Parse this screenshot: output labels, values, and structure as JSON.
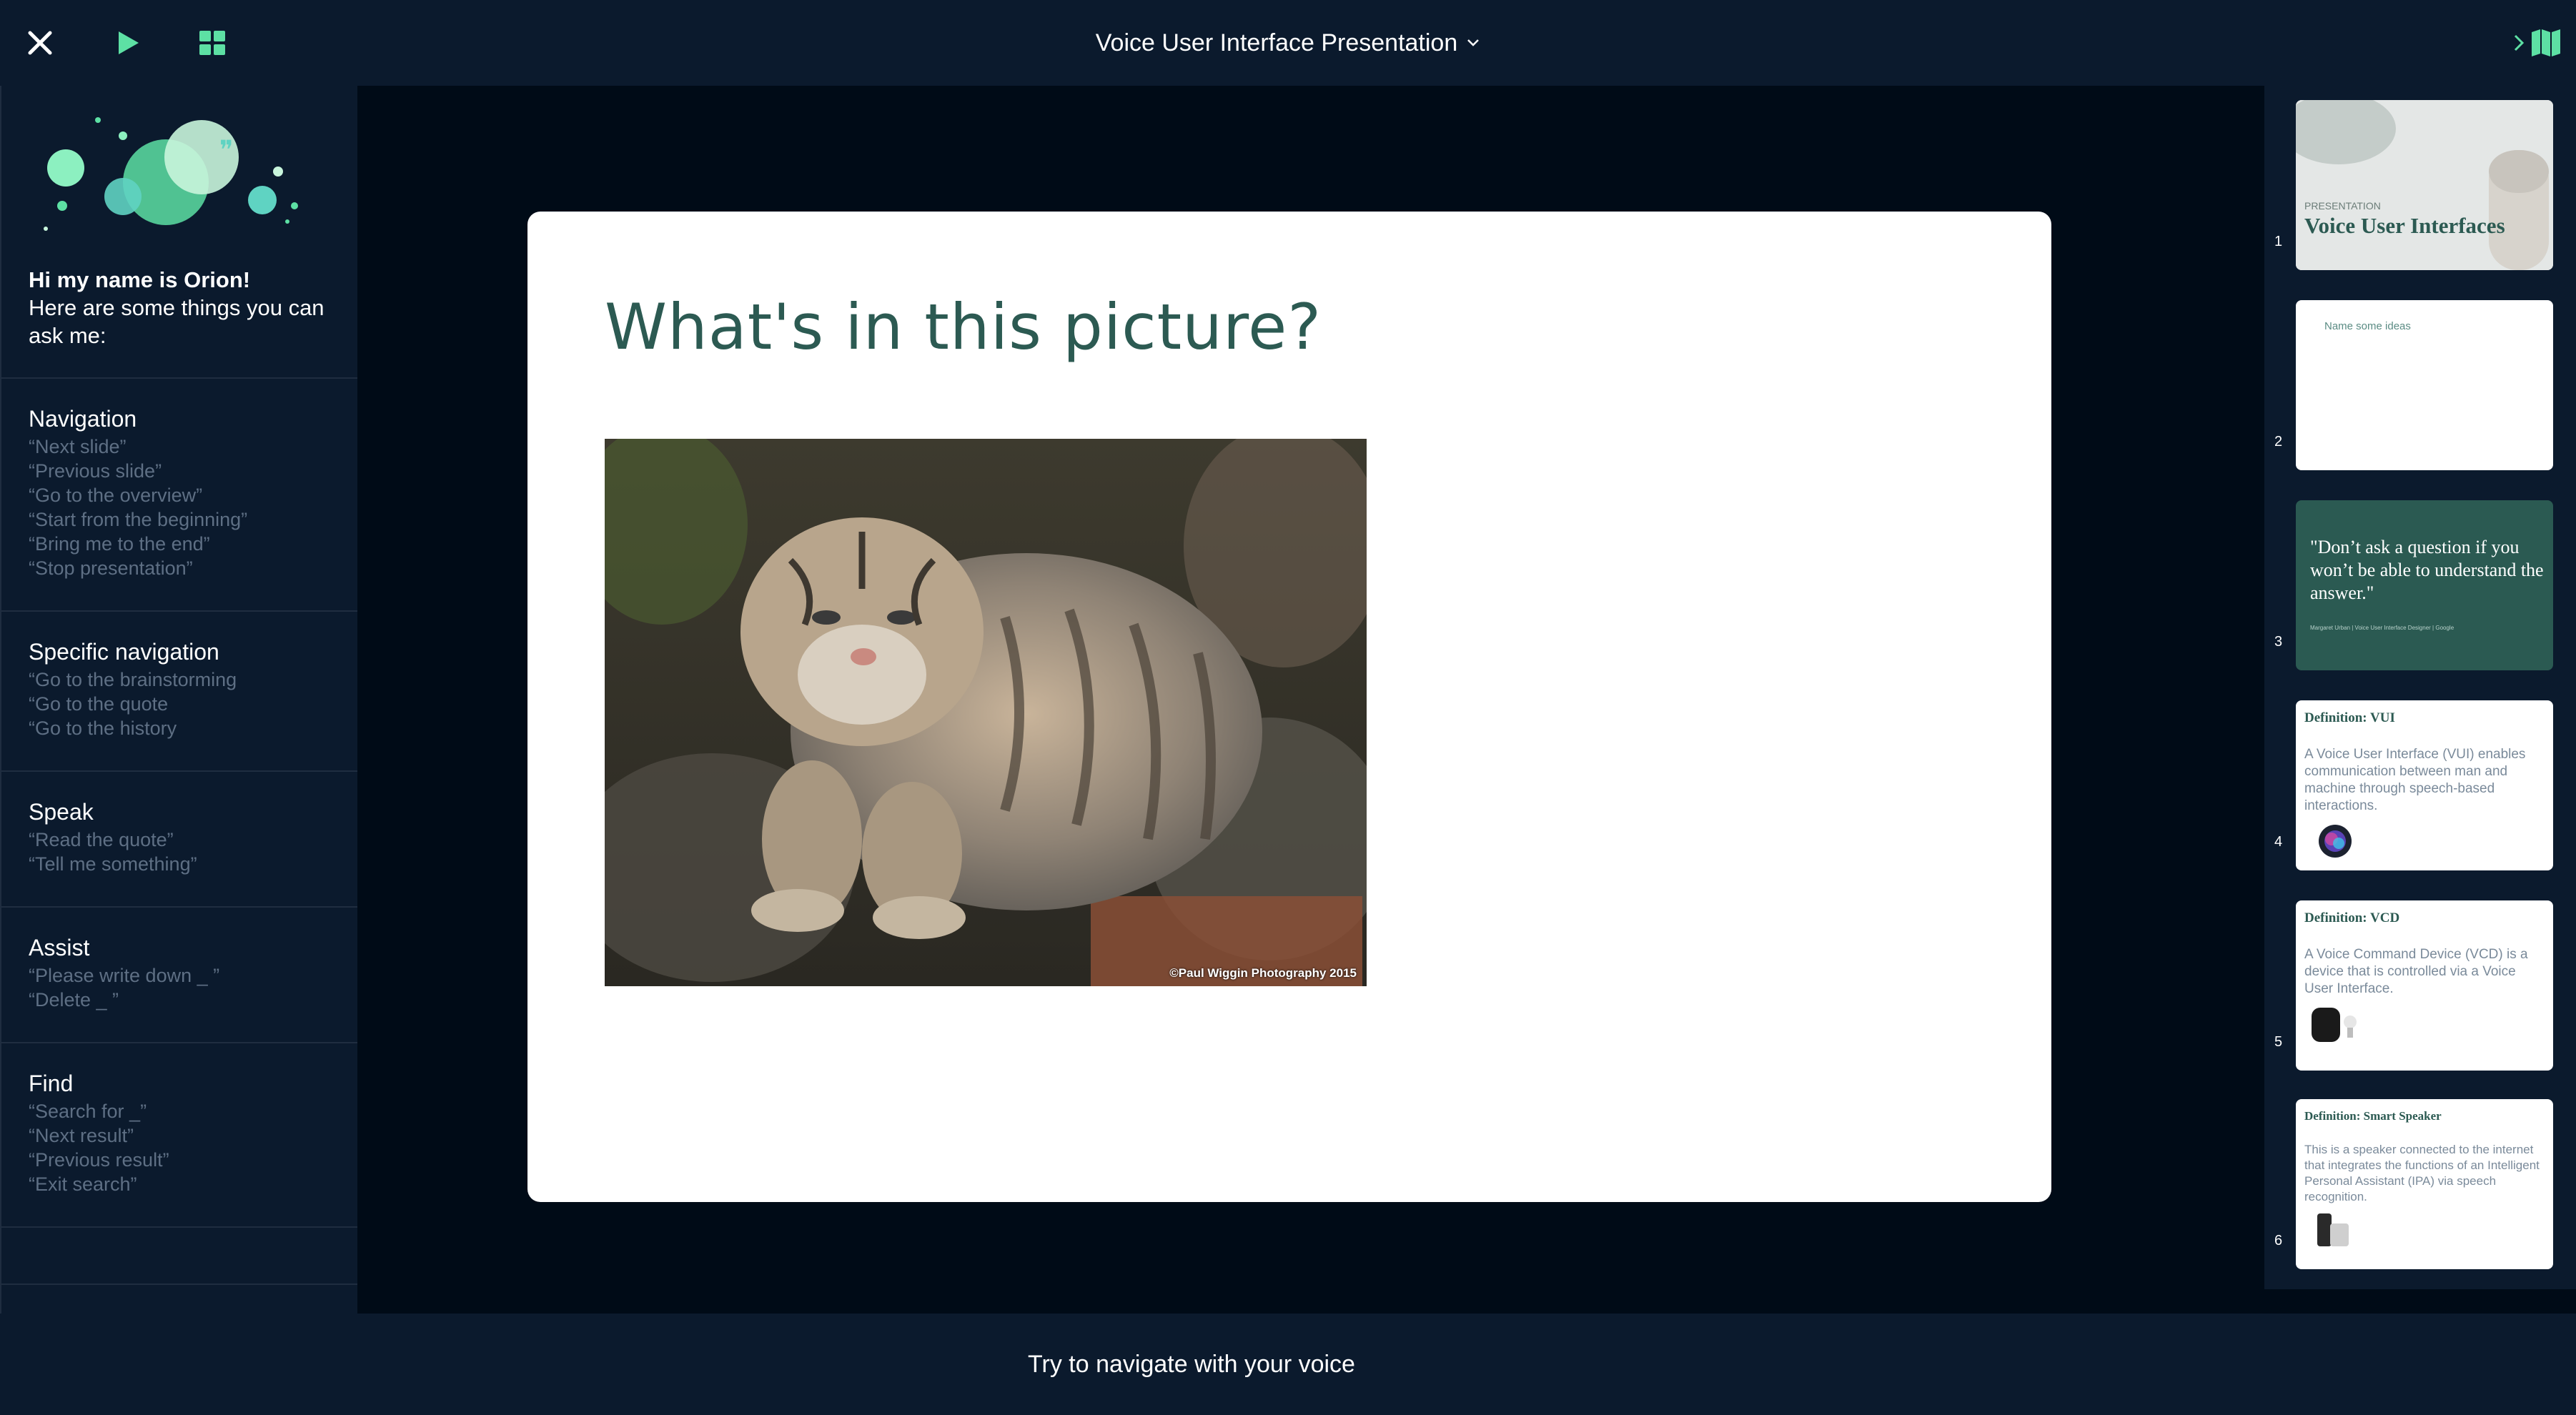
{
  "header": {
    "title": "Voice User Interface Presentation",
    "close_icon": "close-icon",
    "play_icon": "play-icon",
    "grid_icon": "grid-icon",
    "map_icon": "map-icon",
    "accent": "#5de0a4"
  },
  "assistant": {
    "name_line": "Hi my name is Orion!",
    "intro_line": "Here are some things you can ask me:",
    "sections": [
      {
        "title": "Navigation",
        "commands": [
          "“Next slide”",
          "“Previous slide”",
          "“Go to the overview”",
          "“Start from the beginning”",
          "“Bring me to the end”",
          "“Stop presentation”"
        ]
      },
      {
        "title": "Specific navigation",
        "commands": [
          "“Go to the brainstorming",
          "“Go to the quote",
          "“Go to the history"
        ]
      },
      {
        "title": "Speak",
        "commands": [
          "“Read the quote”",
          "“Tell me something”"
        ]
      },
      {
        "title": "Assist",
        "commands": [
          "“Please write down _ ”",
          "“Delete _ ”"
        ]
      },
      {
        "title": "Find",
        "commands": [
          "“Search for _”",
          "“Next result”",
          "“Previous result”",
          "“Exit search”"
        ]
      }
    ]
  },
  "slide": {
    "title": "What's in this picture?",
    "image_credit": "©Paul Wiggin Photography 2015"
  },
  "thumbnails": [
    {
      "number": "1",
      "kicker": "PRESENTATION",
      "title": "Voice User Interfaces"
    },
    {
      "number": "2",
      "text": "Name some ideas"
    },
    {
      "number": "3",
      "quote": "\"Don’t ask a question if you won’t be able to understand the answer.\"",
      "attribution": "Margaret Urban | Voice User Interface Designer | Google"
    },
    {
      "number": "4",
      "heading": "Definition: VUI",
      "body": "A Voice User Interface (VUI) enables communication between man and machine through speech-based interactions."
    },
    {
      "number": "5",
      "heading": "Definition: VCD",
      "body": "A Voice Command Device (VCD) is a device that is controlled via a Voice User Interface."
    },
    {
      "number": "6",
      "heading": "Definition: Smart Speaker",
      "body": "This is a speaker connected to the internet that integrates the functions of an Intelligent Personal Assistant (IPA) via speech recognition."
    }
  ],
  "footer": {
    "hint": "Try to navigate with your voice"
  }
}
